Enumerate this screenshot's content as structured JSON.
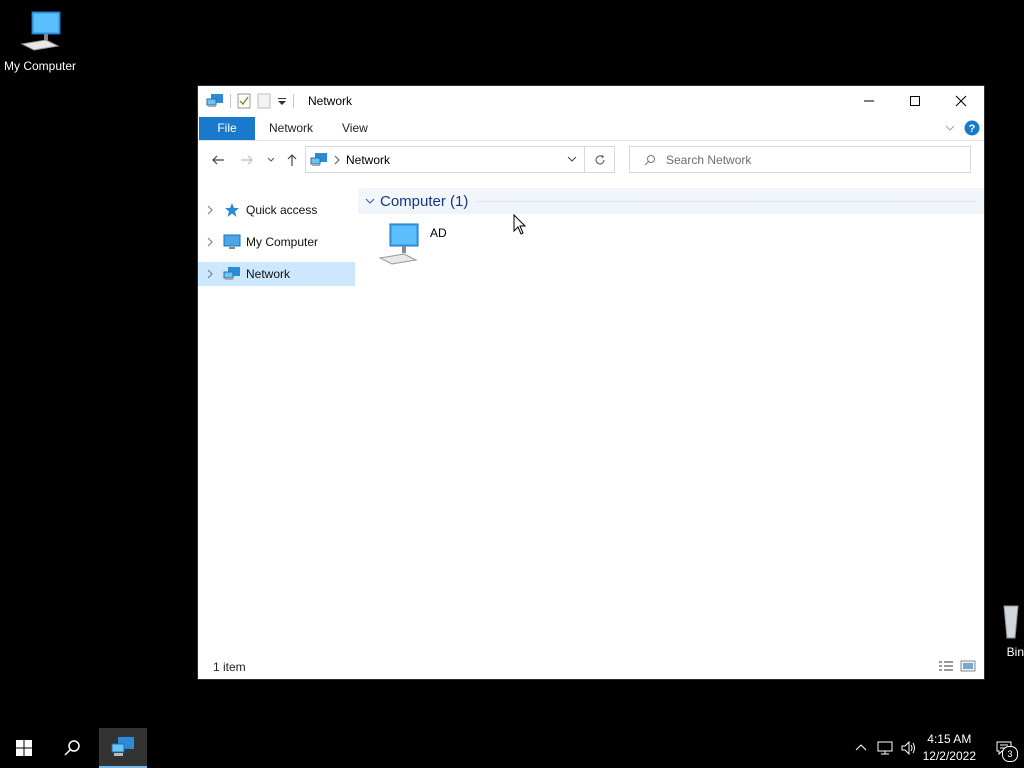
{
  "desktop": {
    "icons": [
      {
        "label": "My Computer"
      },
      {
        "label": "Bin"
      }
    ]
  },
  "window": {
    "title": "Network",
    "ribbon_tabs": [
      "File",
      "Network",
      "View"
    ],
    "address": {
      "crumb": "Network"
    },
    "search": {
      "placeholder": "Search Network"
    },
    "nav_pane": [
      {
        "label": "Quick access"
      },
      {
        "label": "My Computer"
      },
      {
        "label": "Network"
      }
    ],
    "content": {
      "group": {
        "title": "Computer (1)"
      },
      "items": [
        {
          "name": "AD"
        }
      ]
    },
    "status": {
      "text": "1 item"
    }
  },
  "taskbar": {
    "clock": {
      "time": "4:15 AM",
      "date": "12/2/2022"
    },
    "notifications_count": "3"
  },
  "colors": {
    "accent": "#1979ca",
    "selection": "#cce8ff",
    "group_title": "#1e3287",
    "desktop_bg": "#000000"
  }
}
